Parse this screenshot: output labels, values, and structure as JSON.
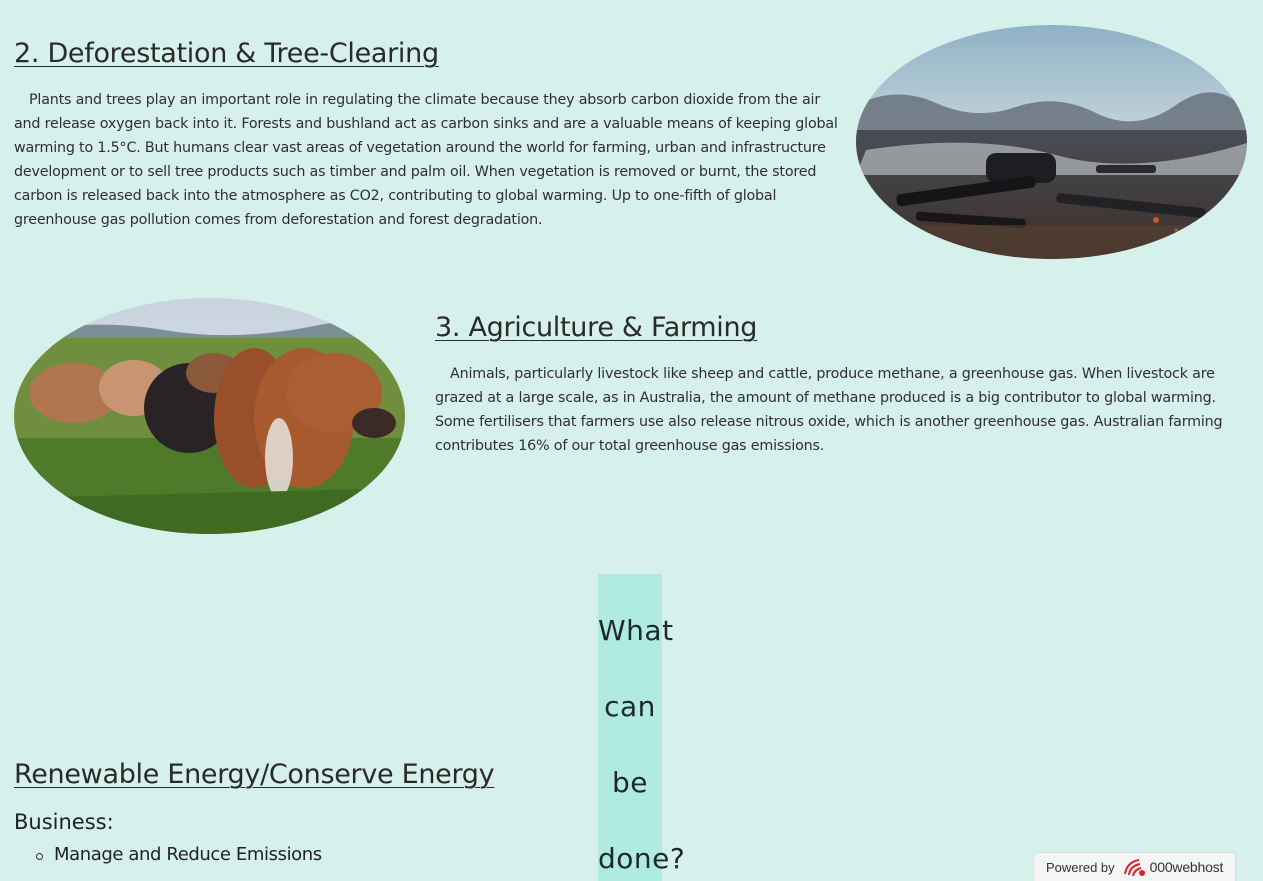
{
  "sections": {
    "deforestation": {
      "title": "2. Deforestation & Tree-Clearing",
      "text": "Plants and trees play an important role in regulating the climate because they absorb carbon dioxide from the air and release oxygen back into it. Forests and bushland act as carbon sinks and are a valuable means of keeping global warming to 1.5°C. But humans clear vast areas of vegetation around the world for farming, urban and infrastructure development or to sell tree products such as timber and palm oil. When vegetation is removed or burnt, the stored carbon is released back into the atmosphere as CO2, contributing to global warming. Up to one-fifth of global greenhouse gas pollution comes from deforestation and forest degradation."
    },
    "agriculture": {
      "title": "3. Agriculture & Farming",
      "text": "Animals, particularly livestock like sheep and cattle, produce methane, a greenhouse gas. When livestock are grazed at a large scale, as in Australia, the amount of methane produced is a big contributor to global warming. Some fertilisers that farmers use also release nitrous oxide, which is another greenhouse gas. Australian farming contributes 16% of our total greenhouse gas emissions."
    }
  },
  "what_heading": {
    "words": [
      "What",
      "can",
      "be",
      "done?"
    ]
  },
  "renewable": {
    "title": "Renewable Energy/Conserve Energy",
    "business_label": "Business:",
    "items": [
      "Manage and Reduce Emissions"
    ]
  },
  "badge": {
    "powered_text": "Powered by",
    "brand": "000webhost"
  }
}
